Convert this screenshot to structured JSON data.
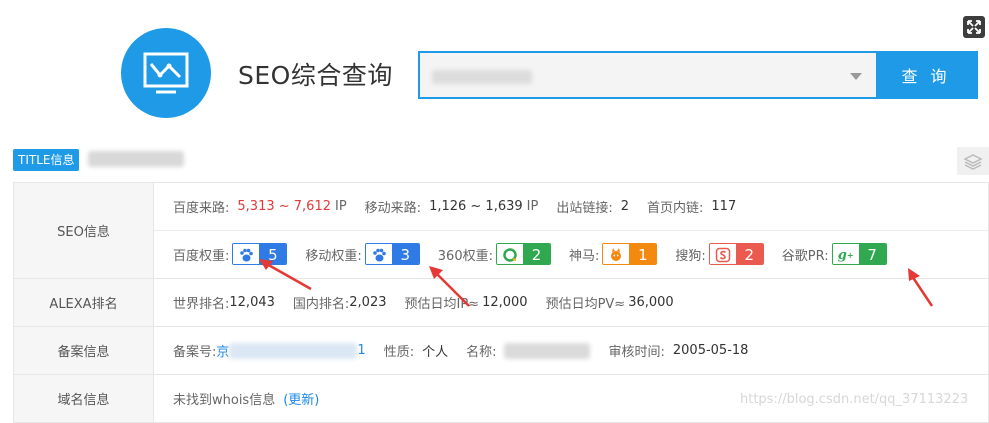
{
  "app": {
    "title": "SEO综合查询",
    "search_button": "查 询",
    "title_badge": "TITLE信息"
  },
  "seo": {
    "label": "SEO信息",
    "baidu_traffic_label": "百度来路:",
    "baidu_traffic_value": "5,313 ~ 7,612",
    "baidu_traffic_unit": "IP",
    "mobile_traffic_label": "移动来路:",
    "mobile_traffic_value": "1,126 ~ 1,639",
    "mobile_traffic_unit": "IP",
    "outlinks_label": "出站链接:",
    "outlinks_value": "2",
    "inlinks_label": "首页内链:",
    "inlinks_value": "117",
    "baidu_weight_label": "百度权重:",
    "baidu_weight_value": "5",
    "mobile_weight_label": "移动权重:",
    "mobile_weight_value": "3",
    "weight360_label": "360权重:",
    "weight360_value": "2",
    "shenma_label": "神马:",
    "shenma_value": "1",
    "sogou_label": "搜狗:",
    "sogou_value": "2",
    "google_pr_label": "谷歌PR:",
    "google_pr_value": "7"
  },
  "alexa": {
    "label": "ALEXA排名",
    "world_rank_label": "世界排名:",
    "world_rank_value": "12,043",
    "china_rank_label": "国内排名:",
    "china_rank_value": "2,023",
    "daily_ip_label": "预估日均IP≈",
    "daily_ip_value": "12,000",
    "daily_pv_label": "预估日均PV≈",
    "daily_pv_value": "36,000"
  },
  "icp": {
    "label": "备案信息",
    "icp_no_label": "备案号:",
    "icp_no_partial": "京",
    "icp_no_tail": "1",
    "nature_label": "性质:",
    "nature_value": "个人",
    "name_label": "名称:",
    "audit_time_label": "审核时间:",
    "audit_time_value": "2005-05-18"
  },
  "whois": {
    "label": "域名信息",
    "text": "未找到whois信息",
    "refresh": "(更新)"
  },
  "watermark": "https://blog.csdn.net/qq_37113223",
  "colors": {
    "accent": "#1e9ae6",
    "red_value": "#e23a3a",
    "arrow": "#e53935"
  }
}
